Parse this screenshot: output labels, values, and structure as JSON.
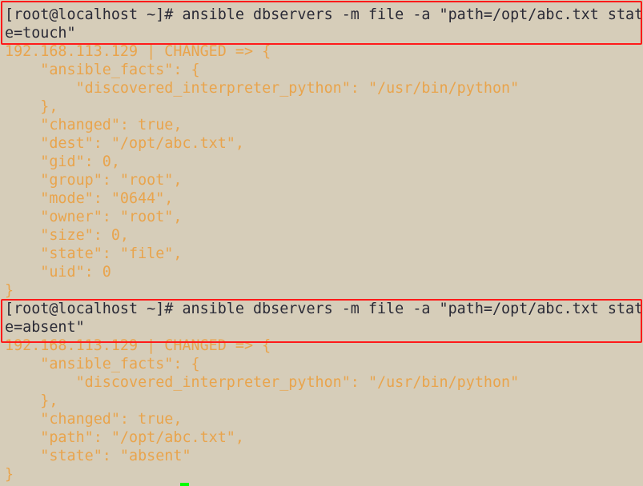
{
  "terminal": {
    "lines": [
      {
        "text": "[root@localhost ~]# ansible dbservers -m file -a \"path=/opt/abc.txt stat",
        "kind": "cmd"
      },
      {
        "text": "e=touch\"",
        "kind": "cmd"
      },
      {
        "text": "192.168.113.129 | CHANGED => {",
        "kind": "out"
      },
      {
        "text": "    \"ansible_facts\": {",
        "kind": "out"
      },
      {
        "text": "        \"discovered_interpreter_python\": \"/usr/bin/python\"",
        "kind": "out"
      },
      {
        "text": "    },",
        "kind": "out"
      },
      {
        "text": "    \"changed\": true,",
        "kind": "out"
      },
      {
        "text": "    \"dest\": \"/opt/abc.txt\",",
        "kind": "out"
      },
      {
        "text": "    \"gid\": 0,",
        "kind": "out"
      },
      {
        "text": "    \"group\": \"root\",",
        "kind": "out"
      },
      {
        "text": "    \"mode\": \"0644\",",
        "kind": "out"
      },
      {
        "text": "    \"owner\": \"root\",",
        "kind": "out"
      },
      {
        "text": "    \"size\": 0,",
        "kind": "out"
      },
      {
        "text": "    \"state\": \"file\",",
        "kind": "out"
      },
      {
        "text": "    \"uid\": 0",
        "kind": "out"
      },
      {
        "text": "}",
        "kind": "out"
      },
      {
        "text": "[root@localhost ~]# ansible dbservers -m file -a \"path=/opt/abc.txt stat",
        "kind": "cmd"
      },
      {
        "text": "e=absent\"",
        "kind": "cmd"
      },
      {
        "text": "192.168.113.129 | CHANGED => {",
        "kind": "out"
      },
      {
        "text": "    \"ansible_facts\": {",
        "kind": "out"
      },
      {
        "text": "        \"discovered_interpreter_python\": \"/usr/bin/python\"",
        "kind": "out"
      },
      {
        "text": "    },",
        "kind": "out"
      },
      {
        "text": "    \"changed\": true,",
        "kind": "out"
      },
      {
        "text": "    \"path\": \"/opt/abc.txt\",",
        "kind": "out"
      },
      {
        "text": "    \"state\": \"absent\"",
        "kind": "out"
      },
      {
        "text": "}",
        "kind": "out"
      }
    ]
  },
  "colors": {
    "background": "#d6cdb9",
    "command": "#2a2a36",
    "output": "#e9a44c",
    "highlight_box": "#ff1a1a",
    "cursor": "#00ff00"
  }
}
